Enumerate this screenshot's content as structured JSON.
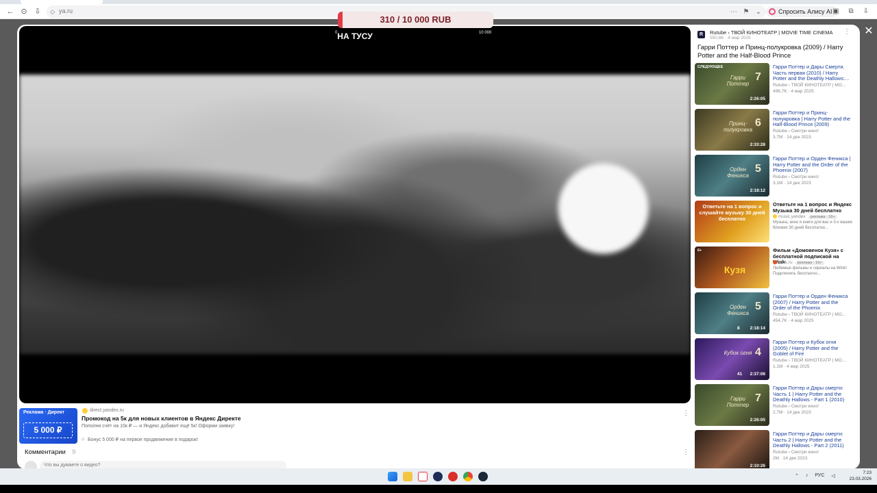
{
  "browser": {
    "address": "ya.ru",
    "alice_label": "Спросить Алису AI"
  },
  "donation": {
    "text": "310 / 10 000 RUB",
    "progress": 0.031,
    "min_label": "0",
    "max_label": "10 000"
  },
  "player": {
    "title": "НА ТУСУ"
  },
  "ad_under_player": {
    "thumb_brand": "Реклама · Директ",
    "thumb_amount": "5 000 ₽",
    "domain": "direct.yandex.ru",
    "title": "Промокод на 5к для новых клиентов в Яндекс Директе",
    "description": "Пополни счёт на 10к ₽ — и Яндекс добавит ещё 5к! Оформи заявку!",
    "bonus": "Бонус 5 000 ₽ на первое продвижение в подарок!"
  },
  "comments": {
    "label": "Комментарии",
    "count": "9",
    "placeholder": "Что вы думаете о видео?"
  },
  "sidebar": {
    "channel": "Rutube › ТВОЙ КИНОТЕАТР | MOVIE TIME CINEMA",
    "channel_meta": "550,8K · 4 мар 2025",
    "title": "Гарри Поттер и Принц-полукровка (2009) / Harry Potter and the Half-Blood Prince",
    "recommendations": [
      {
        "title": "Гарри Поттер и Дары Смерти. Часть первая (2010) / Harry Potter and the Deathly Hallows:...",
        "source": "Rutube › ТВОЙ КИНОТЕАТР | МО...",
        "meta": "496,7K · 4 мар 2025",
        "duration": "2:26:05",
        "badge": "СЛЕДУЮЩЕЕ",
        "thumb_text": "Гарри Поттер",
        "thumb_num": "7",
        "comments": ""
      },
      {
        "title": "Гарри Поттер и Принц-полукровка | Harry Potter and the Half-Blood Prince (2009)",
        "source": "Rutube › Смотри кино!",
        "meta": "3,7M · 14 дек 2023",
        "duration": "2:33:28",
        "badge": "",
        "thumb_text": "Принц-полукровка",
        "thumb_num": "6",
        "comments": ""
      },
      {
        "title": "Гарри Поттер и Орден Феникса | Harry Potter and the Order of the Phoenix (2007)",
        "source": "Rutube › Смотри кино!",
        "meta": "3,1M · 14 дек 2023",
        "duration": "2:18:12",
        "badge": "",
        "thumb_text": "Орден Феникса",
        "thumb_num": "5",
        "comments": ""
      },
      {
        "title": "Ответьте на 1 вопрос и Яндекс Музыка 30 дней бесплатно",
        "source": "music.yandex",
        "ad_label": "реклама · 16+",
        "meta": "Музыка, кино и книги для вас и 3-х ваших близких 30 дней бесплатно...",
        "duration": "",
        "badge": "",
        "thumb_text": "Ответьте на 1 вопрос и слушайте музыку 30 дней бесплатно",
        "thumb_num": "",
        "comments": ""
      },
      {
        "title": "Фильм «Домовенок Кузя» с бесплатной подпиской на Wink",
        "source": "wink.ru",
        "ad_label": "реклама · 16+",
        "meta": "Любимые фильмы и сериалы на Wink! Подключить бесплатно...",
        "duration": "",
        "badge": "6+",
        "thumb_text": "Кузя",
        "thumb_num": "",
        "comments": ""
      },
      {
        "title": "Гарри Поттер и Орден Феникса (2007) / Harry Potter and the Order of the Phoenix",
        "source": "Rutube › ТВОЙ КИНОТЕАТР | МО...",
        "meta": "454,7K · 4 мар 2025",
        "duration": "2:18:14",
        "badge": "",
        "thumb_text": "Орден Феникса",
        "thumb_num": "5",
        "comments": "8"
      },
      {
        "title": "Гарри Поттер и Кубок огня (2005) / Harry Potter and the Goblet of Fire",
        "source": "Rutube › ТВОЙ КИНОТЕАТР | МО...",
        "meta": "1,1M · 4 мар 2025",
        "duration": "2:37:06",
        "badge": "",
        "thumb_text": "Кубок огня",
        "thumb_num": "4",
        "comments": "41"
      },
      {
        "title": "Гарри Поттер и Дары смерти: Часть 1 | Harry Potter and the Deathly Hallows - Part 1 (2010)",
        "source": "Rutube › Смотри кино!",
        "meta": "2,7M · 14 дек 2023",
        "duration": "2:26:05",
        "badge": "",
        "thumb_text": "Гарри Поттер",
        "thumb_num": "7",
        "comments": ""
      },
      {
        "title": "Гарри Поттер и Дары смерти: Часть 2 | Harry Potter and the Deathly Hallows - Part 2 (2011)",
        "source": "Rutube › Смотри кино!",
        "meta": "2M · 14 дек 2023",
        "duration": "2:10:26",
        "badge": "",
        "thumb_text": "",
        "thumb_num": "",
        "comments": ""
      }
    ]
  },
  "taskbar": {
    "lang": "РУС",
    "time": "7:23",
    "date": "23.03.2026"
  },
  "colors": {
    "donation_accent": "#e33a48",
    "link_blue": "#1a3f99",
    "ad_blue": "#2a69f5"
  }
}
